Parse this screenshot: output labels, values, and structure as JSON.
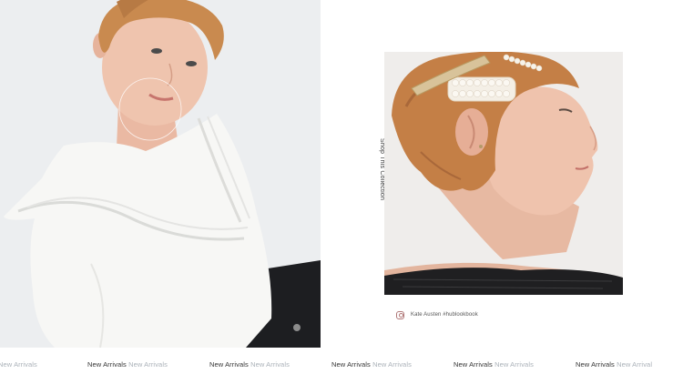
{
  "left_image": {
    "alt_description": "model in white ruffled top and black jeans"
  },
  "right_image": {
    "alt_description": "profile portrait with pearl hair clips"
  },
  "collection_cta": {
    "label": "Shop This Collection"
  },
  "credit": {
    "icon": "instagram-icon",
    "text": "Kate Austen #hublookbook",
    "icon_color": "#b07878"
  },
  "marquee": {
    "items": [
      {
        "dark": "",
        "light": "New Arrivals"
      },
      {
        "dark": "New Arrivals",
        "light": "New Arrivals"
      },
      {
        "dark": "New Arrivals",
        "light": "New Arrivals"
      },
      {
        "dark": "New Arrivals",
        "light": "New Arrivals"
      },
      {
        "dark": "New Arrivals",
        "light": "New Arrivals"
      },
      {
        "dark": "New Arrivals",
        "light": "New Arrival"
      }
    ],
    "dark_color": "#333333",
    "light_color": "#aab1b8"
  }
}
